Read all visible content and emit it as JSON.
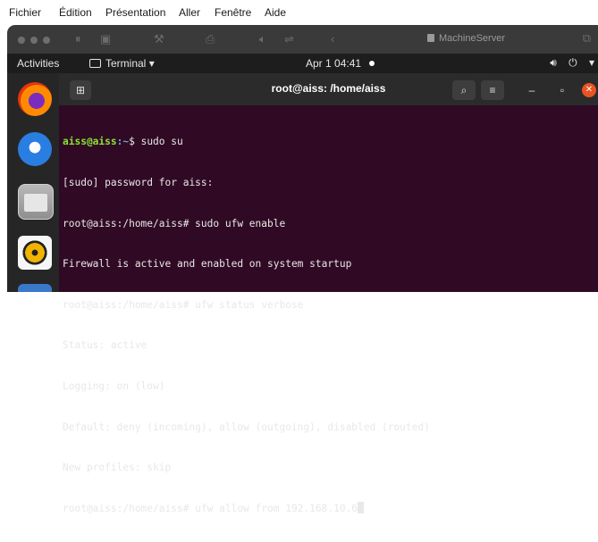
{
  "mac_menu": [
    "Fichier",
    "Édition",
    "Présentation",
    "Aller",
    "Fenêtre",
    "Aide"
  ],
  "vm": {
    "title": "MachineServer"
  },
  "ubuntu_bar": {
    "activities": "Activities",
    "app_menu": "Terminal",
    "clock": "Apr 1  04:41"
  },
  "terminal": {
    "title": "root@aiss: /home/aiss",
    "lines": [
      {
        "user": "aiss@aiss",
        "path": ":~",
        "cmd": "$ sudo su"
      },
      {
        "text": "[sudo] password for aiss:"
      },
      {
        "text": "root@aiss:/home/aiss# sudo ufw enable"
      },
      {
        "text": "Firewall is active and enabled on system startup"
      },
      {
        "text": "root@aiss:/home/aiss# ufw status verbose"
      },
      {
        "text": "Status: active"
      },
      {
        "text": "Logging: on (low)"
      },
      {
        "text": "Default: deny (incoming), allow (outgoing), disabled (routed)"
      },
      {
        "text": "New profiles: skip"
      },
      {
        "text": "root@aiss:/home/aiss# ufw allow from 192.168.10.6"
      }
    ]
  },
  "colors": {
    "terminal_bg": "#300a24",
    "dock_bg": "#262626",
    "close_button": "#e95420",
    "prompt_green": "#8ae234",
    "path_blue": "#729fcf"
  }
}
